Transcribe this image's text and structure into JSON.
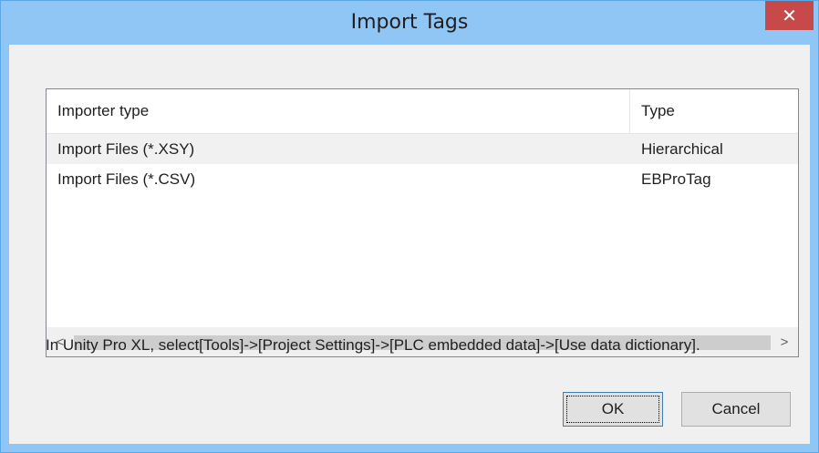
{
  "dialog": {
    "title": "Import Tags",
    "close_label": "✕"
  },
  "list": {
    "columns": [
      "Importer type",
      "Type"
    ],
    "rows": [
      {
        "importer": "Import Files (*.XSY)",
        "type": "Hierarchical",
        "selected": true
      },
      {
        "importer": "Import Files (*.CSV)",
        "type": "EBProTag",
        "selected": false
      }
    ],
    "scroll_left": "<",
    "scroll_right": ">"
  },
  "info_text": "In Unity Pro XL, select[Tools]->[Project Settings]->[PLC embedded data]->[Use data dictionary].",
  "buttons": {
    "ok": "OK",
    "cancel": "Cancel"
  }
}
